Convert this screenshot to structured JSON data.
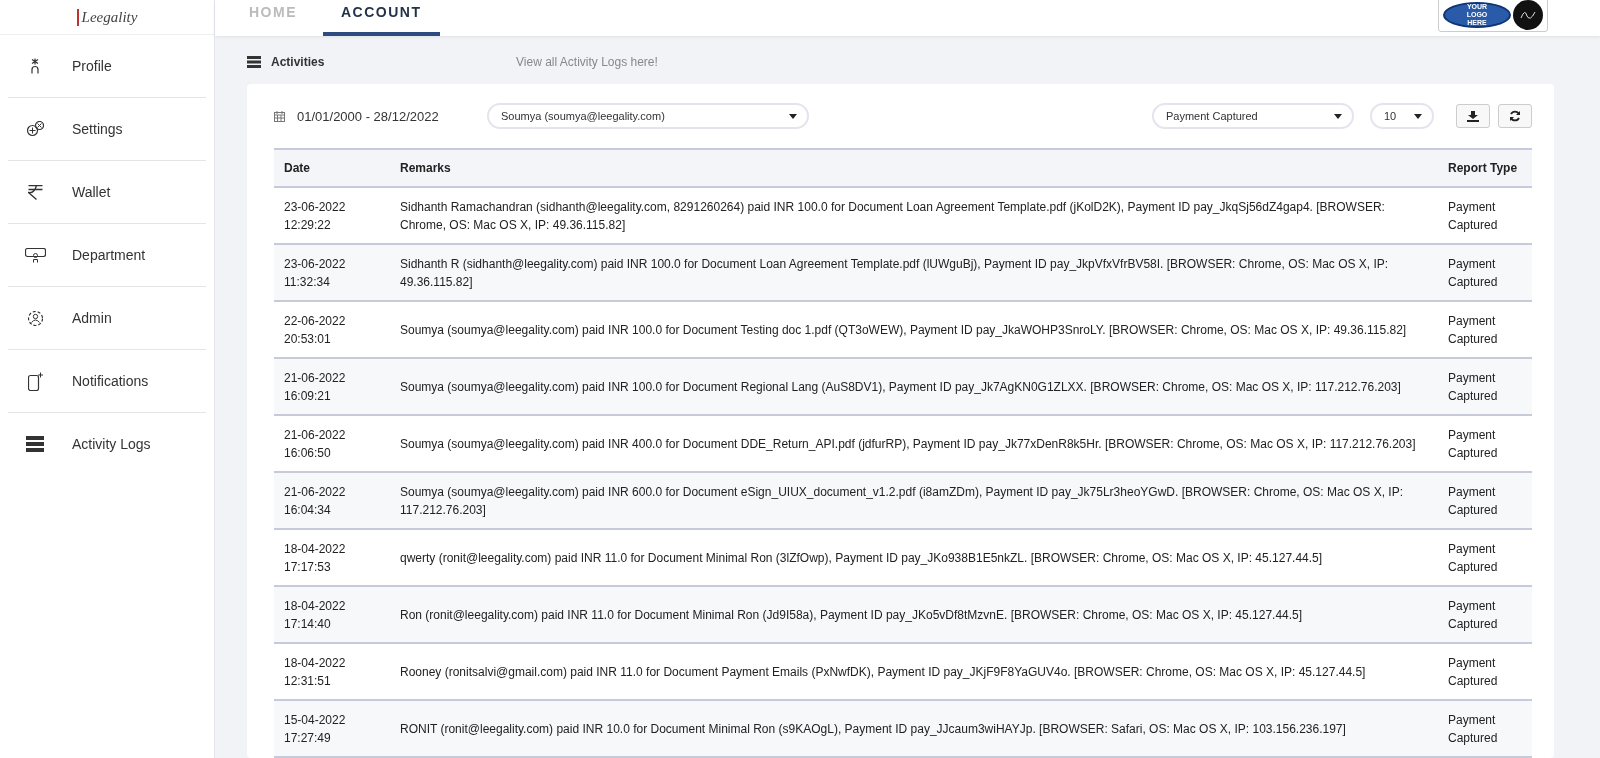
{
  "brand": {
    "logo_text": "Leegality",
    "partner_logo_text": "YOUR LOGO HERE"
  },
  "tabs": [
    {
      "label": "HOME",
      "selected": false
    },
    {
      "label": "ACCOUNT",
      "selected": true
    }
  ],
  "sidebar": {
    "items": [
      {
        "label": "Profile",
        "kind": "profile",
        "selected": false
      },
      {
        "label": "Settings",
        "kind": "settings",
        "selected": false
      },
      {
        "label": "Wallet",
        "kind": "wallet",
        "selected": false
      },
      {
        "label": "Department",
        "kind": "department",
        "selected": false
      },
      {
        "label": "Admin",
        "kind": "admin",
        "selected": false
      },
      {
        "label": "Notifications",
        "kind": "notifications",
        "selected": false
      },
      {
        "label": "Activity Logs",
        "kind": "logs",
        "selected": false
      }
    ]
  },
  "page": {
    "title": "Activities",
    "hint": "View all Activity Logs here!"
  },
  "filters": {
    "date_range": "01/01/2000 - 28/12/2022",
    "user": "Soumya (soumya@leegality.com)",
    "report_type": "Payment Captured",
    "page_size": "10"
  },
  "table": {
    "columns": [
      "Date",
      "Remarks",
      "Report Type"
    ],
    "rows": [
      {
        "date": "23-06-2022 12:29:22",
        "remarks": "Sidhanth Ramachandran (sidhanth@leegality.com, 8291260264) paid INR 100.0 for Document Loan Agreement Template.pdf (jKolD2K), Payment ID pay_JkqSj56dZ4gap4. [BROWSER: Chrome, OS: Mac OS X, IP: 49.36.115.82]",
        "type": "Payment Captured"
      },
      {
        "date": "23-06-2022 11:32:34",
        "remarks": "Sidhanth R (sidhanth@leegality.com) paid INR 100.0 for Document Loan Agreement Template.pdf (lUWguBj), Payment ID pay_JkpVfxVfrBV58I. [BROWSER: Chrome, OS: Mac OS X, IP: 49.36.115.82]",
        "type": "Payment Captured"
      },
      {
        "date": "22-06-2022 20:53:01",
        "remarks": "Soumya (soumya@leegality.com) paid INR 100.0 for Document Testing doc 1.pdf (QT3oWEW), Payment ID pay_JkaWOHP3SnroLY. [BROWSER: Chrome, OS: Mac OS X, IP: 49.36.115.82]",
        "type": "Payment Captured"
      },
      {
        "date": "21-06-2022 16:09:21",
        "remarks": "Soumya (soumya@leegality.com) paid INR 100.0 for Document Regional Lang (AuS8DV1), Payment ID pay_Jk7AgKN0G1ZLXX. [BROWSER: Chrome, OS: Mac OS X, IP: 117.212.76.203]",
        "type": "Payment Captured"
      },
      {
        "date": "21-06-2022 16:06:50",
        "remarks": "Soumya (soumya@leegality.com) paid INR 400.0 for Document DDE_Return_API.pdf (jdfurRP), Payment ID pay_Jk77xDenR8k5Hr. [BROWSER: Chrome, OS: Mac OS X, IP: 117.212.76.203]",
        "type": "Payment Captured"
      },
      {
        "date": "21-06-2022 16:04:34",
        "remarks": "Soumya (soumya@leegality.com) paid INR 600.0 for Document eSign_UIUX_document_v1.2.pdf (i8amZDm), Payment ID pay_Jk75Lr3heoYGwD. [BROWSER: Chrome, OS: Mac OS X, IP: 117.212.76.203]",
        "type": "Payment Captured"
      },
      {
        "date": "18-04-2022 17:17:53",
        "remarks": "qwerty (ronit@leegality.com) paid INR 11.0 for Document Minimal Ron (3lZfOwp), Payment ID pay_JKo938B1E5nkZL. [BROWSER: Chrome, OS: Mac OS X, IP: 45.127.44.5]",
        "type": "Payment Captured"
      },
      {
        "date": "18-04-2022 17:14:40",
        "remarks": "Ron (ronit@leegality.com) paid INR 11.0 for Document Minimal Ron (Jd9I58a), Payment ID pay_JKo5vDf8tMzvnE. [BROWSER: Chrome, OS: Mac OS X, IP: 45.127.44.5]",
        "type": "Payment Captured"
      },
      {
        "date": "18-04-2022 12:31:51",
        "remarks": "Rooney (ronitsalvi@gmail.com) paid INR 11.0 for Document Payment Emails (PxNwfDK), Payment ID pay_JKjF9F8YaGUV4o. [BROWSER: Chrome, OS: Mac OS X, IP: 45.127.44.5]",
        "type": "Payment Captured"
      },
      {
        "date": "15-04-2022 17:27:49",
        "remarks": "RONIT (ronit@leegality.com) paid INR 10.0 for Document Minimal Ron (s9KAOgL), Payment ID pay_JJcaum3wiHAYJp. [BROWSER: Safari, OS: Mac OS X, IP: 103.156.236.197]",
        "type": "Payment Captured"
      }
    ]
  }
}
